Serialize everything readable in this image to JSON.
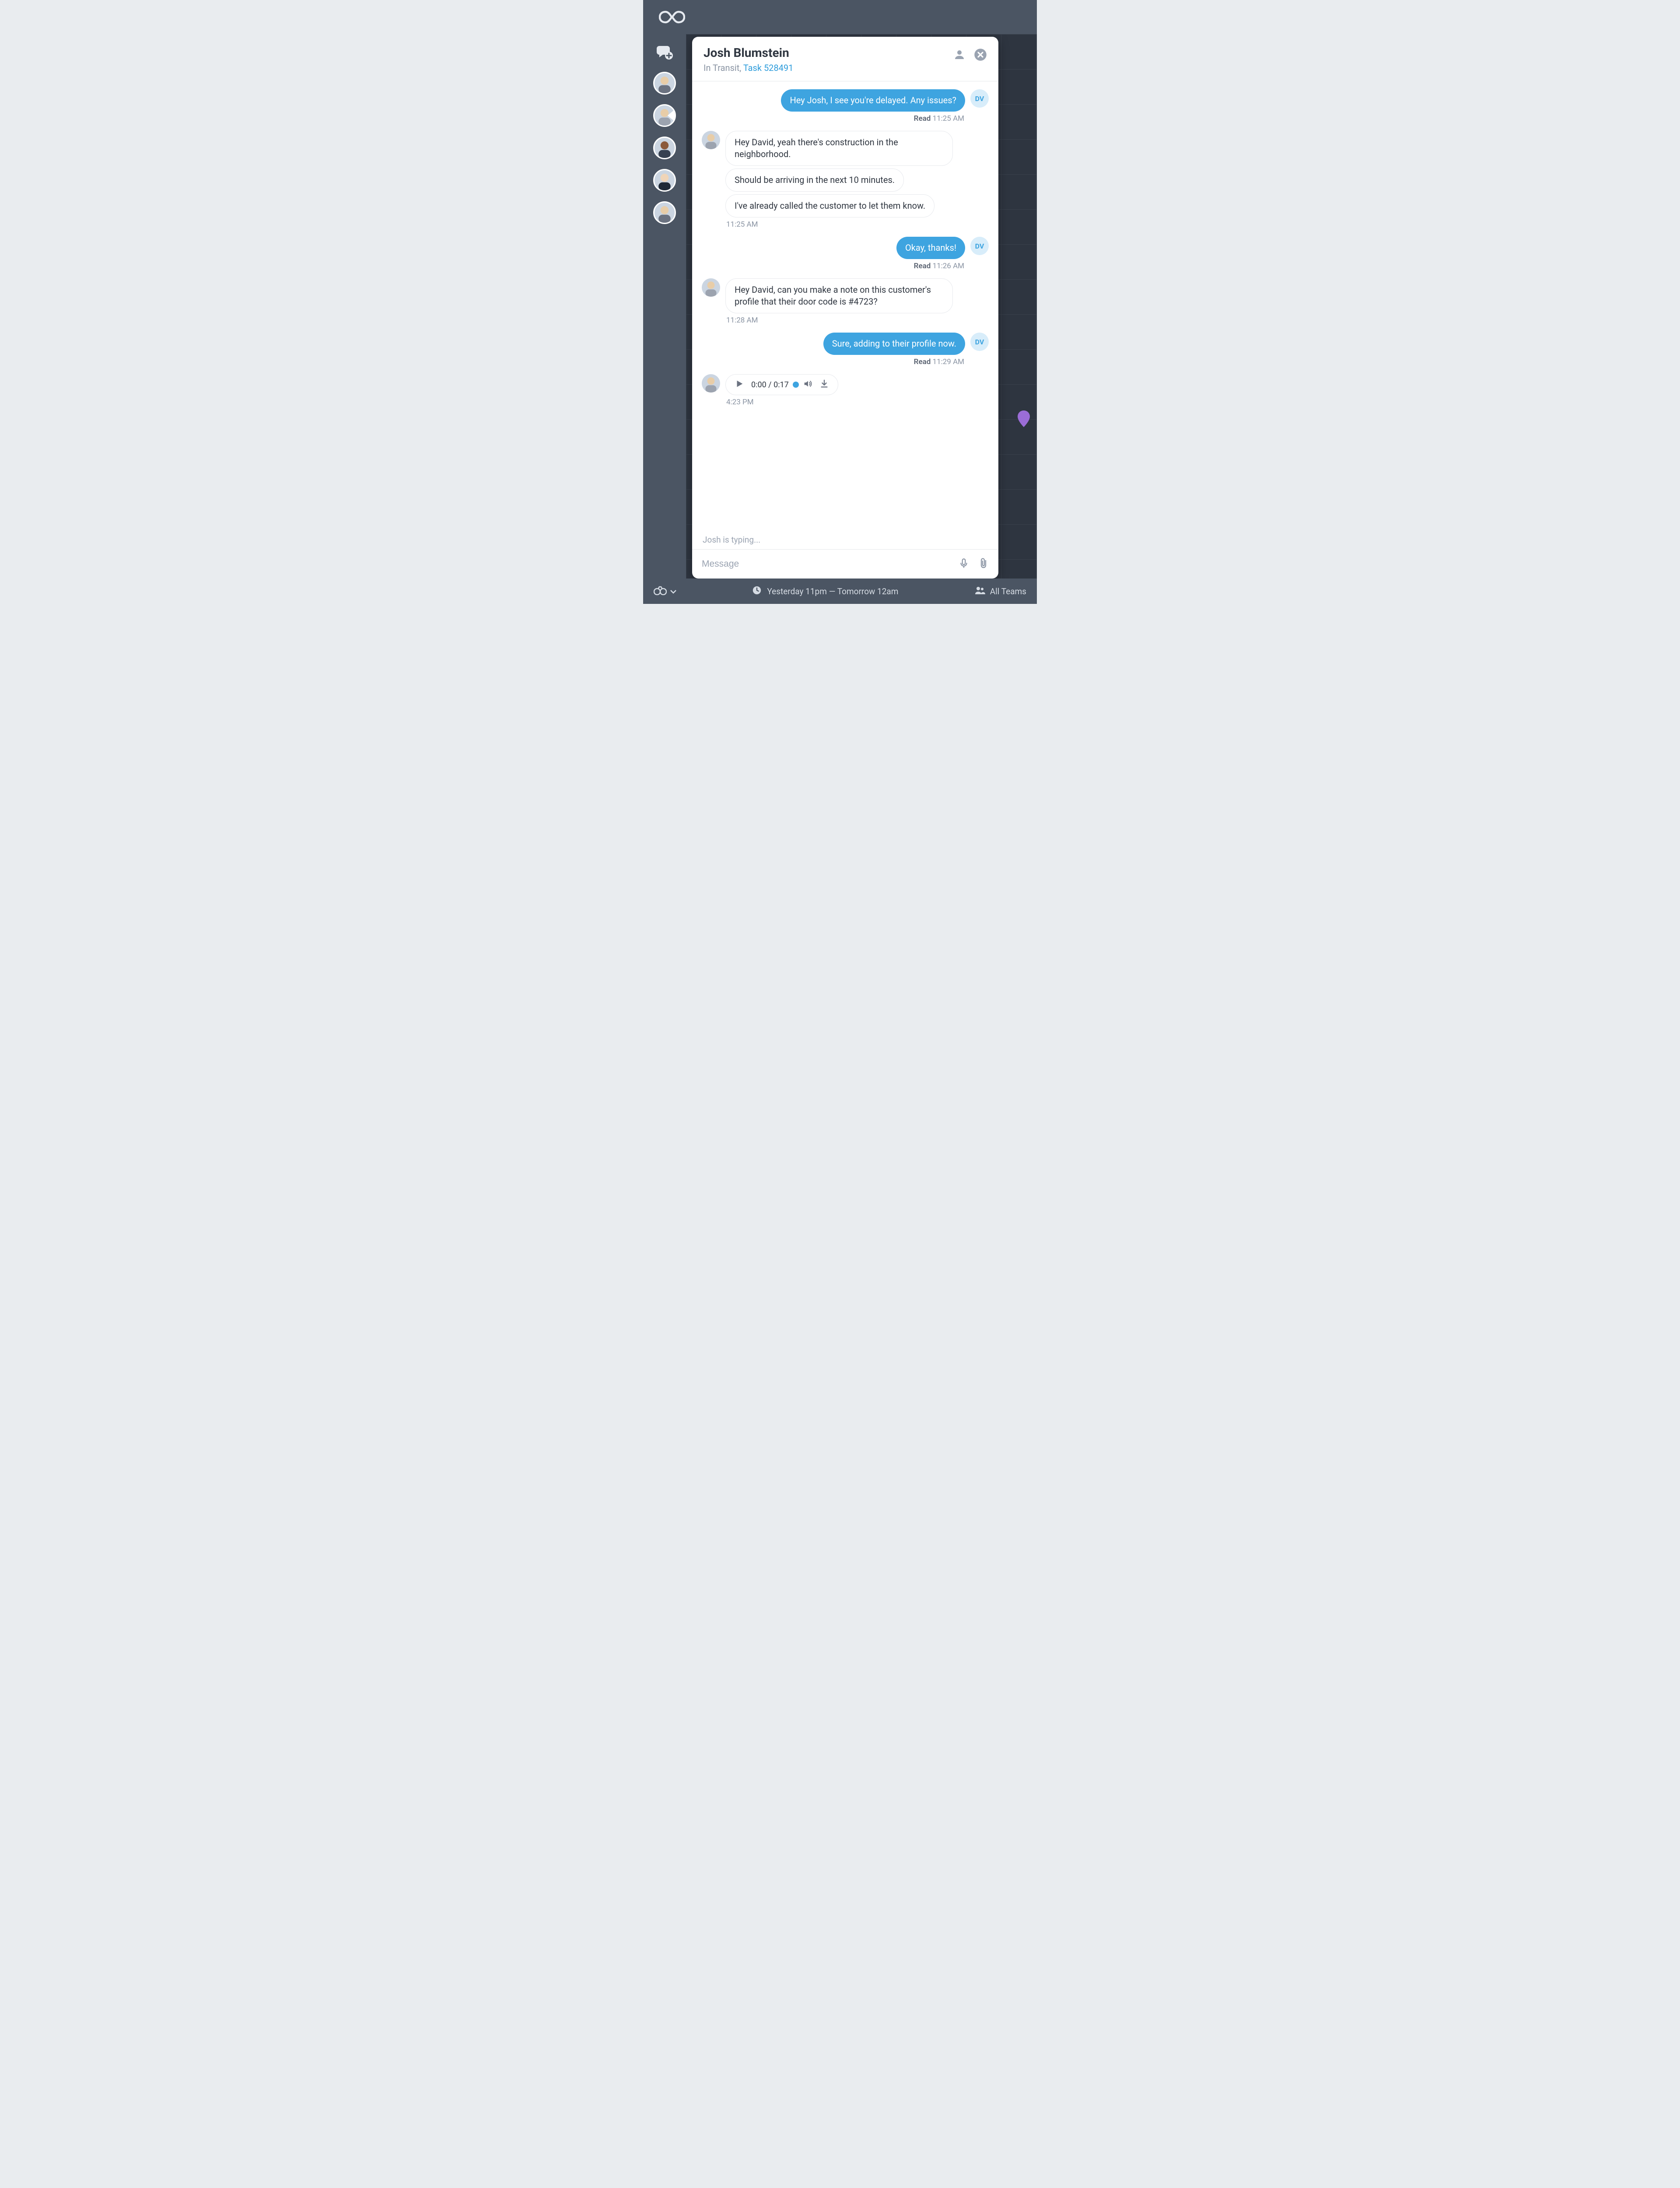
{
  "chat": {
    "contact_name": "Josh Blumstein",
    "status_prefix": "In Transit, ",
    "task_link": "Task 528491",
    "typing_indicator": "Josh is typing...",
    "composer_placeholder": "Message",
    "self_initials": "DV"
  },
  "messages": {
    "m1": {
      "text": "Hey Josh, I see you're delayed. Any issues?"
    },
    "m1_meta_bold": "Read",
    "m1_meta_time": " 11:25 AM",
    "m2a": {
      "text": "Hey David, yeah there's construction in the neighborhood."
    },
    "m2b": {
      "text": "Should be arriving in the next 10 minutes."
    },
    "m2c": {
      "text": "I've already called the customer to let them know."
    },
    "m2_meta": "11:25 AM",
    "m3": {
      "text": "Okay, thanks!"
    },
    "m3_meta_bold": "Read",
    "m3_meta_time": " 11:26 AM",
    "m4": {
      "text": "Hey David, can you make a note on this customer's profile that their door code is #4723?"
    },
    "m4_meta": "11:28 AM",
    "m5": {
      "text": "Sure, adding to their profile now."
    },
    "m5_meta_bold": "Read",
    "m5_meta_time": " 11:29 AM",
    "audio": {
      "position": "0:00",
      "sep": " / ",
      "duration": "0:17"
    },
    "audio_meta": "4:23 PM"
  },
  "bottombar": {
    "time_range": "Yesterday 11pm — Tomorrow 12am",
    "team_label": "All Teams"
  }
}
